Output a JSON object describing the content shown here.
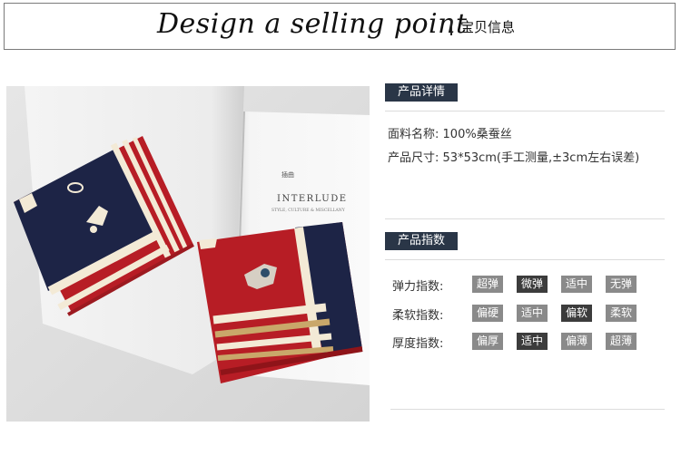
{
  "header": {
    "title_script": "Design a selling point",
    "subtitle": "宝贝信息"
  },
  "photo": {
    "book_title_small": "插曲",
    "book_title": "INTERLUDE",
    "book_subtitle": "STYLE, CULTURE & MISCELLANY"
  },
  "details": {
    "section_label": "产品详情",
    "material_label": "面料名称:",
    "material_value": "100%桑蚕丝",
    "size_label": "产品尺寸:",
    "size_value": "53*53cm(手工测量,±3cm左右误差)"
  },
  "indices": {
    "section_label": "产品指数",
    "rows": [
      {
        "label": "弹力指数:",
        "options": [
          "超弹",
          "微弹",
          "适中",
          "无弹"
        ],
        "selected": 1
      },
      {
        "label": "柔软指数:",
        "options": [
          "偏硬",
          "适中",
          "偏软",
          "柔软"
        ],
        "selected": 2
      },
      {
        "label": "厚度指数:",
        "options": [
          "偏厚",
          "适中",
          "偏薄",
          "超薄"
        ],
        "selected": 1
      }
    ]
  },
  "colors": {
    "badge_bg": "#2a3647",
    "chip_inactive": "#8a8a8a",
    "chip_selected": "#3c3c3c",
    "scarf_navy": "#1d2446",
    "scarf_red": "#b71d25",
    "scarf_cream": "#f3ead6",
    "scarf_tan": "#c9a76a"
  }
}
